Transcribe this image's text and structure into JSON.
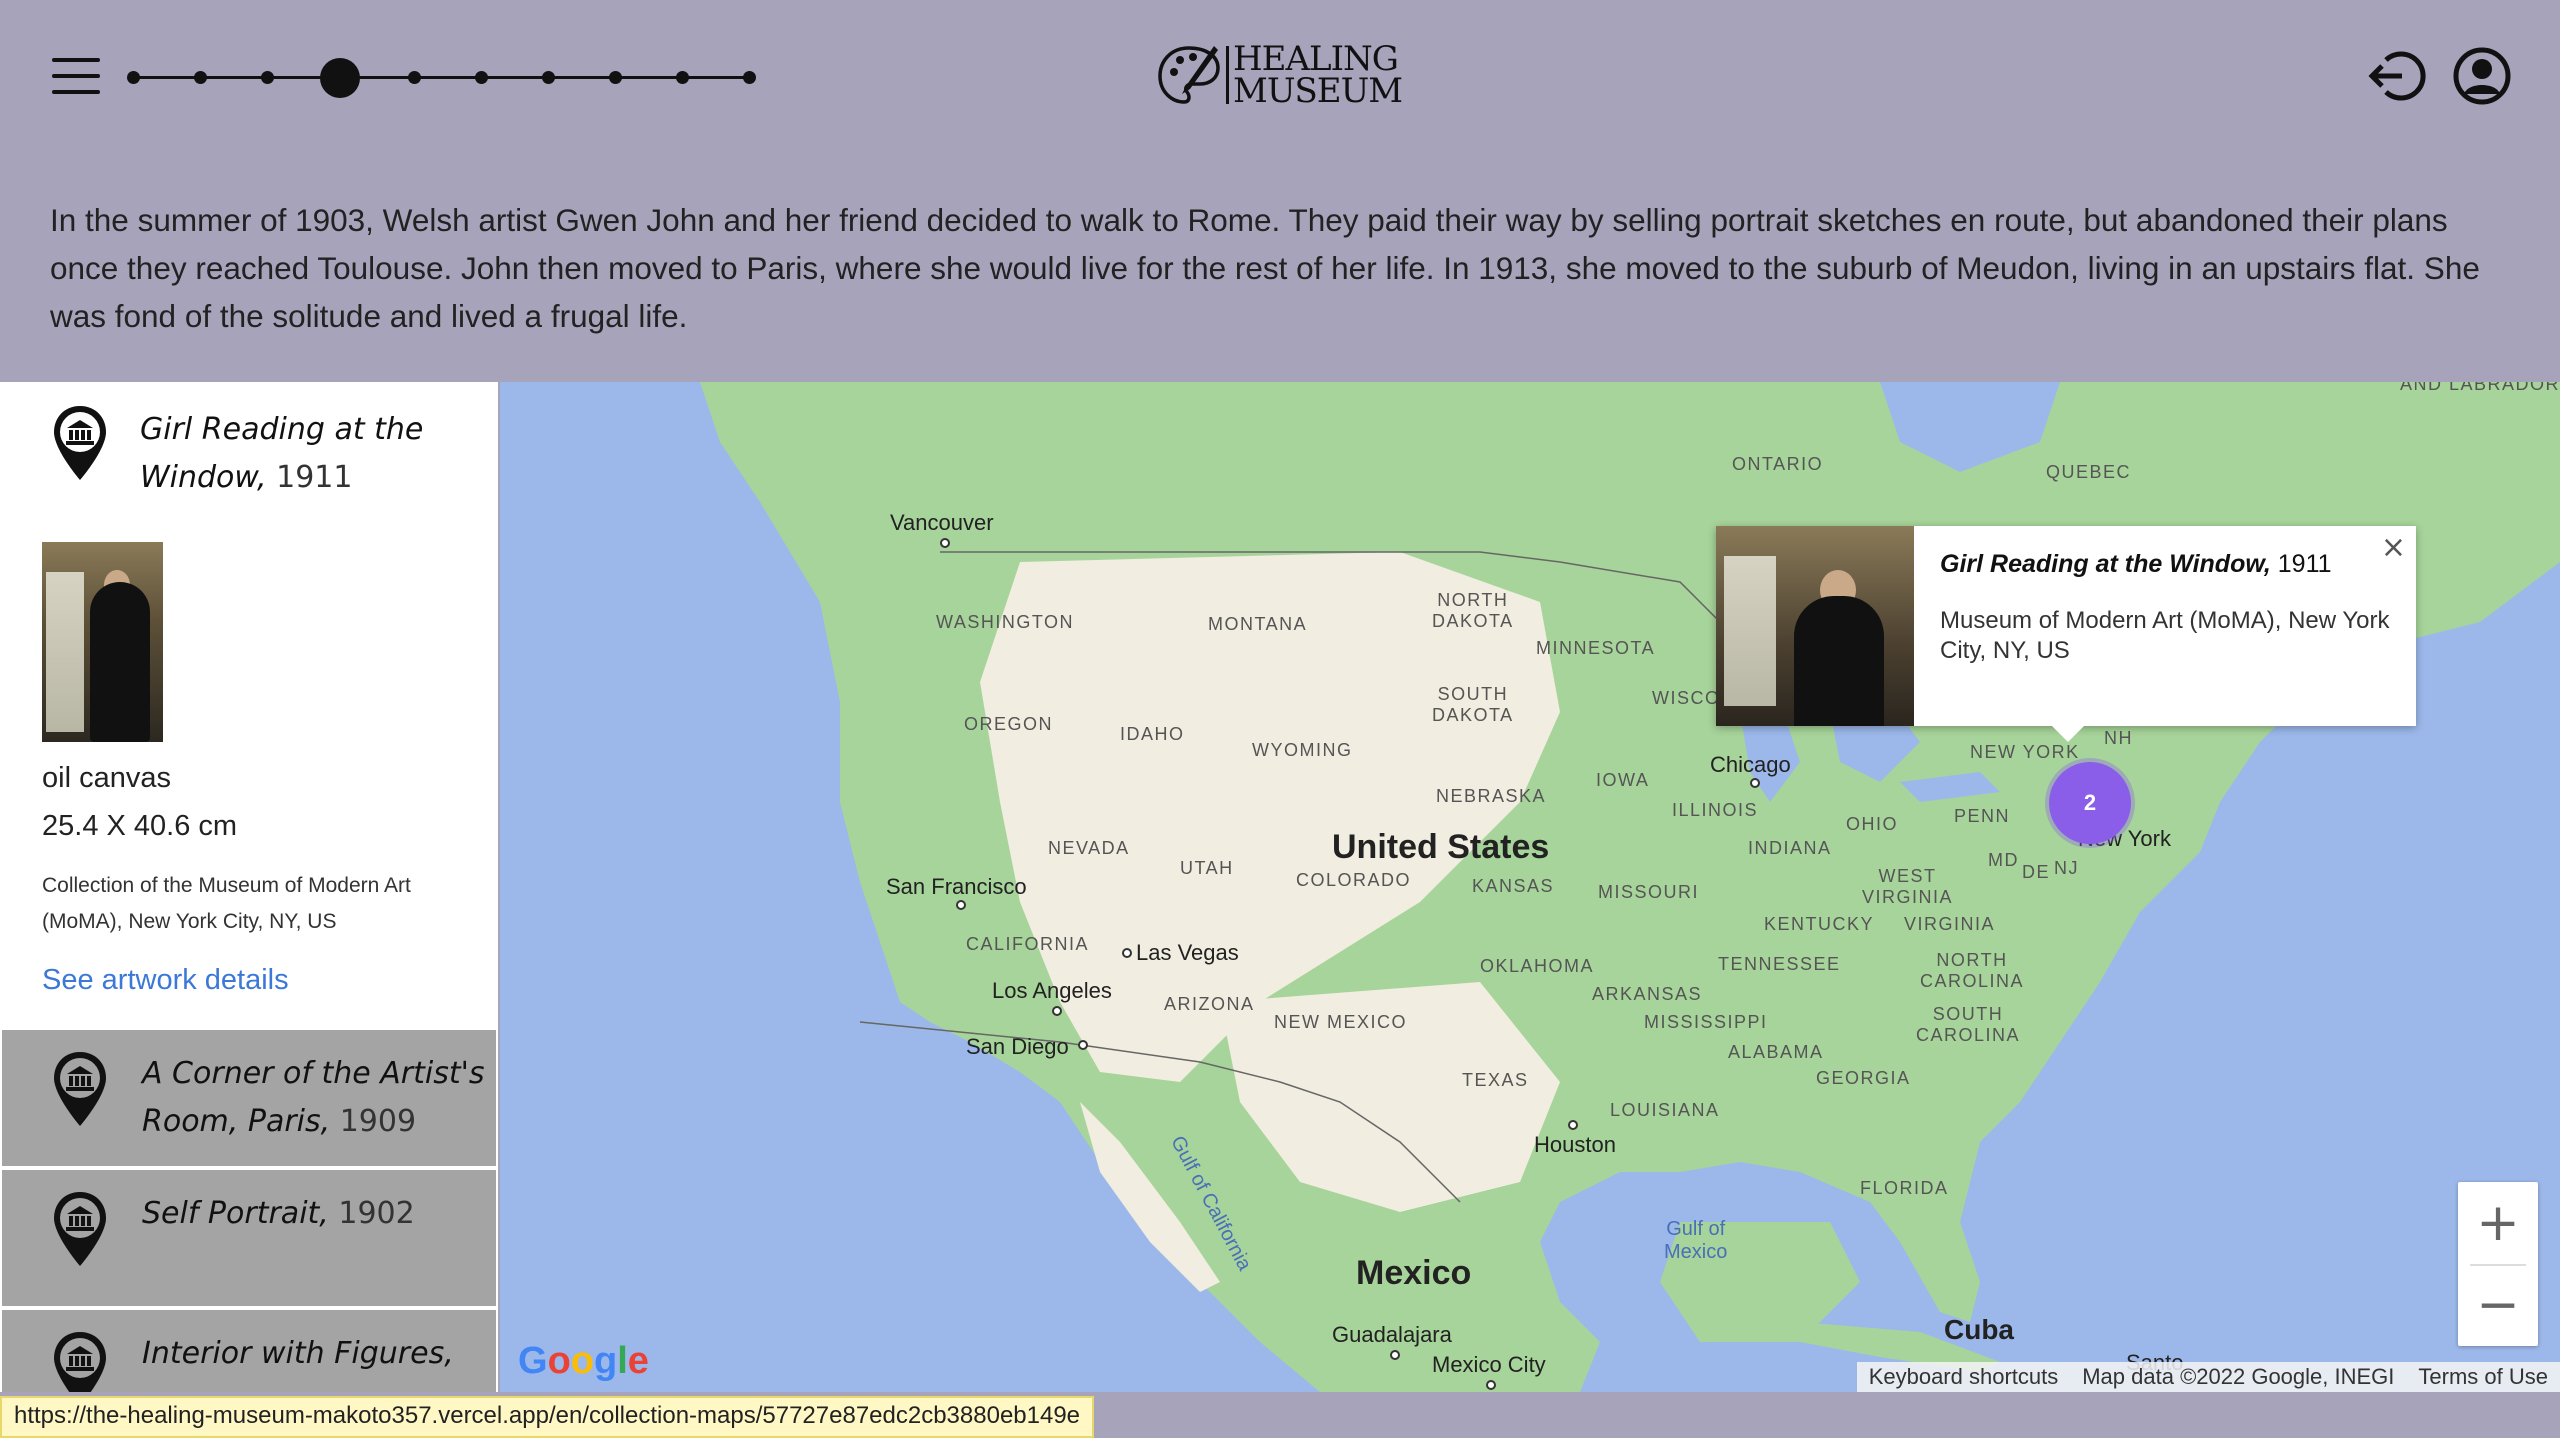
{
  "header": {
    "logo_line1": "HEALING",
    "logo_line2": "MUSEUM",
    "timeline_stops": 10,
    "timeline_active_index": 3
  },
  "intro": {
    "text": "In the summer of 1903, Welsh artist Gwen John and her friend decided to walk to Rome. They paid their way by selling portrait sketches en route, but abandoned their plans once they reached Toulouse. John then moved to Paris, where she would live for the rest of her life. In 1913, she moved to the suburb of Meudon, living in an upstairs flat. She was fond of the solitude and lived a frugal life."
  },
  "sidebar": {
    "active": {
      "title_line1": "Girl Reading at the",
      "title_line2": "Window,",
      "year": "1911",
      "medium": "oil canvas",
      "dimensions": "25.4 X 40.6 cm",
      "collection": "Collection of the Museum of Modern Art (MoMA), New York City, NY, US",
      "details_link": "See artwork details"
    },
    "items": [
      {
        "title_line1": "A Corner of the Artist's",
        "title_line2": "Room, Paris,",
        "year": "1909"
      },
      {
        "title_line1": "Self Portrait,",
        "title_line2": "",
        "year": "1902"
      },
      {
        "title_line1": "Interior with Figures,",
        "title_line2": "",
        "year": ""
      }
    ]
  },
  "map": {
    "country_labels": {
      "us": "United States",
      "mexico": "Mexico",
      "cuba": "Cuba"
    },
    "water_labels": {
      "gulf_mexico": "Gulf of\nMexico",
      "gulf_california": "Gulf of California"
    },
    "regions": {
      "ontario": "ONTARIO",
      "quebec": "QUEBEC",
      "labrador": "AND LABRADOR",
      "washington": "WASHINGTON",
      "montana": "MONTANA",
      "north_dakota": "NORTH\nDAKOTA",
      "minnesota": "MINNESOTA",
      "oregon": "OREGON",
      "idaho": "IDAHO",
      "wyoming": "WYOMING",
      "south_dakota": "SOUTH\nDAKOTA",
      "wisconsin": "WISCO",
      "iowa": "IOWA",
      "nebraska": "NEBRASKA",
      "illinois": "ILLINOIS",
      "nevada": "NEVADA",
      "utah": "UTAH",
      "colorado": "COLORADO",
      "kansas": "KANSAS",
      "missouri": "MISSOURI",
      "indiana": "INDIANA",
      "ohio": "OHIO",
      "penn": "PENN",
      "new_york": "NEW YORK",
      "nh": "NH",
      "md": "MD",
      "de": "DE",
      "nj": "NJ",
      "west_virginia": "WEST\nVIRGINIA",
      "virginia": "VIRGINIA",
      "kentucky": "KENTUCKY",
      "california": "CALIFORNIA",
      "arizona": "ARIZONA",
      "new_mexico": "NEW MEXICO",
      "oklahoma": "OKLAHOMA",
      "arkansas": "ARKANSAS",
      "tennessee": "TENNESSEE",
      "north_carolina": "NORTH\nCAROLINA",
      "mississippi": "MISSISSIPPI",
      "alabama": "ALABAMA",
      "georgia": "GEORGIA",
      "south_carolina": "SOUTH\nCAROLINA",
      "texas": "TEXAS",
      "louisiana": "LOUISIANA",
      "florida": "FLORIDA"
    },
    "cities": {
      "vancouver": "Vancouver",
      "chicago": "Chicago",
      "san_francisco": "San Francisco",
      "las_vegas": "Las Vegas",
      "los_angeles": "Los Angeles",
      "san_diego": "San Diego",
      "houston": "Houston",
      "new_york": "New York",
      "guadalajara": "Guadalajara",
      "mexico_city": "Mexico City",
      "santo": "Santo"
    },
    "cluster_count": "2",
    "popup": {
      "title": "Girl Reading at the Window,",
      "year": "1911",
      "location": "Museum of Modern Art (MoMA), New York City, NY, US",
      "close": "×"
    },
    "zoom_in": "+",
    "zoom_out": "−",
    "attribution": {
      "shortcuts": "Keyboard shortcuts",
      "data": "Map data ©2022 Google, INEGI",
      "terms": "Terms of Use"
    },
    "google": "Google"
  },
  "status_url": "https://the-healing-museum-makoto357.vercel.app/en/collection-maps/57727e87edc2cb3880eb149e",
  "colors": {
    "header_bg": "#a7a3bb",
    "water": "#9cb8ea",
    "land_green": "#a7d49a",
    "land_tan": "#f1ede0",
    "cluster": "#8a5ee8",
    "link": "#3c78d8",
    "card_gray": "#a4a4a4"
  }
}
